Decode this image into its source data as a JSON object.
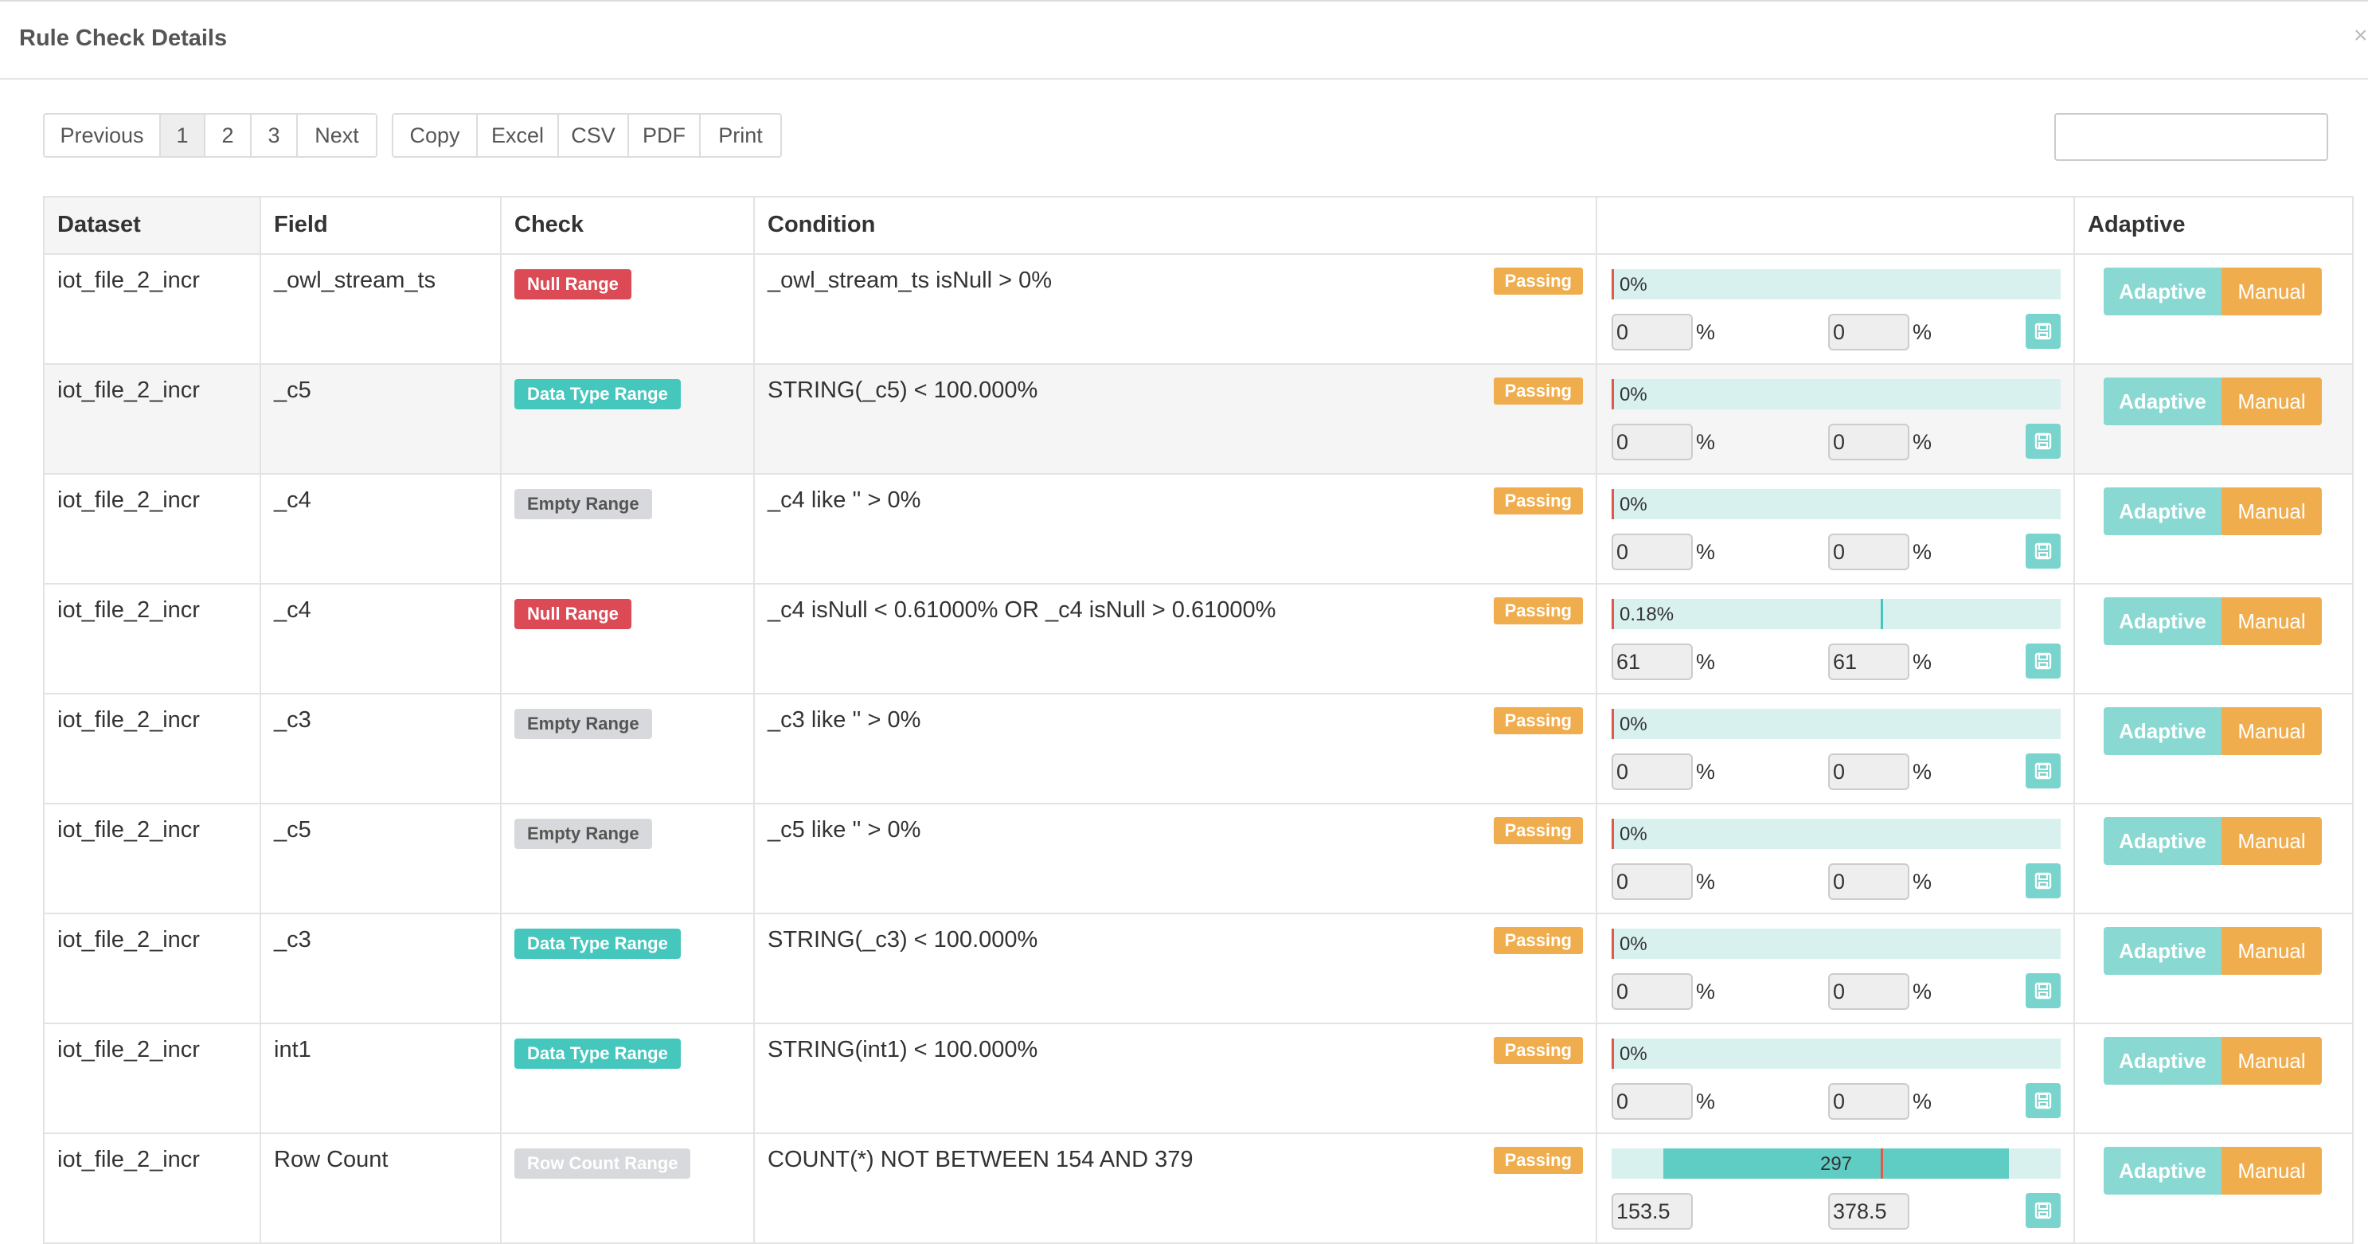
{
  "modal": {
    "title": "Rule Check Details",
    "close_glyph": "×"
  },
  "pagination": {
    "previous": "Previous",
    "pages": [
      "1",
      "2",
      "3"
    ],
    "active_page": "1",
    "next": "Next"
  },
  "export_buttons": [
    "Copy",
    "Excel",
    "CSV",
    "PDF",
    "Print"
  ],
  "search": {
    "value": "",
    "placeholder": ""
  },
  "table": {
    "headers": [
      "Dataset",
      "Field",
      "Check",
      "Condition",
      "",
      "Adaptive"
    ],
    "rows": [
      {
        "dataset": "iot_file_2_incr",
        "field": "_owl_stream_ts",
        "check": "Null Range",
        "check_type": "null",
        "condition": "_owl_stream_ts isNull > 0%",
        "status": "Passing",
        "bar_label": "0%",
        "bar_fill": 0.0,
        "bar_marker": null,
        "low": "0",
        "high": "0",
        "pct": "%",
        "adaptive": "Adaptive",
        "manual": "Manual"
      },
      {
        "dataset": "iot_file_2_incr",
        "field": "_c5",
        "check": "Data Type Range",
        "check_type": "dtype",
        "condition": "STRING(_c5) < 100.000%",
        "status": "Passing",
        "bar_label": "0%",
        "bar_fill": 0.0,
        "bar_marker": null,
        "low": "0",
        "high": "0",
        "pct": "%",
        "adaptive": "Adaptive",
        "manual": "Manual"
      },
      {
        "dataset": "iot_file_2_incr",
        "field": "_c4",
        "check": "Empty Range",
        "check_type": "empty",
        "condition": "_c4 like '' > 0%",
        "status": "Passing",
        "bar_label": "0%",
        "bar_fill": 0.0,
        "bar_marker": null,
        "low": "0",
        "high": "0",
        "pct": "%",
        "adaptive": "Adaptive",
        "manual": "Manual"
      },
      {
        "dataset": "iot_file_2_incr",
        "field": "_c4",
        "check": "Null Range",
        "check_type": "null",
        "condition": "_c4 isNull < 0.61000% OR _c4 isNull > 0.61000%",
        "status": "Passing",
        "bar_label": "0.18%",
        "bar_fill": 0.0,
        "bar_marker": 0.6,
        "low": "61",
        "high": "61",
        "pct": "%",
        "adaptive": "Adaptive",
        "manual": "Manual"
      },
      {
        "dataset": "iot_file_2_incr",
        "field": "_c3",
        "check": "Empty Range",
        "check_type": "empty",
        "condition": "_c3 like '' > 0%",
        "status": "Passing",
        "bar_label": "0%",
        "bar_fill": 0.0,
        "bar_marker": null,
        "low": "0",
        "high": "0",
        "pct": "%",
        "adaptive": "Adaptive",
        "manual": "Manual"
      },
      {
        "dataset": "iot_file_2_incr",
        "field": "_c5",
        "check": "Empty Range",
        "check_type": "empty",
        "condition": "_c5 like '' > 0%",
        "status": "Passing",
        "bar_label": "0%",
        "bar_fill": 0.0,
        "bar_marker": null,
        "low": "0",
        "high": "0",
        "pct": "%",
        "adaptive": "Adaptive",
        "manual": "Manual"
      },
      {
        "dataset": "iot_file_2_incr",
        "field": "_c3",
        "check": "Data Type Range",
        "check_type": "dtype",
        "condition": "STRING(_c3) < 100.000%",
        "status": "Passing",
        "bar_label": "0%",
        "bar_fill": 0.0,
        "bar_marker": null,
        "low": "0",
        "high": "0",
        "pct": "%",
        "adaptive": "Adaptive",
        "manual": "Manual"
      },
      {
        "dataset": "iot_file_2_incr",
        "field": "int1",
        "check": "Data Type Range",
        "check_type": "dtype",
        "condition": "STRING(int1) < 100.000%",
        "status": "Passing",
        "bar_label": "0%",
        "bar_fill": 0.0,
        "bar_marker": null,
        "low": "0",
        "high": "0",
        "pct": "%",
        "adaptive": "Adaptive",
        "manual": "Manual"
      },
      {
        "dataset": "iot_file_2_incr",
        "field": "Row Count",
        "check": "Row Count Range",
        "check_type": "rowcount",
        "condition": "COUNT(*) NOT BETWEEN 154 AND 379",
        "status": "Passing",
        "bar_label": "297",
        "bar_fill_range": [
          0.115,
          0.885
        ],
        "bar_marker": 0.6,
        "low": "153.5",
        "high": "378.5",
        "pct": "",
        "adaptive": "Adaptive",
        "manual": "Manual"
      }
    ]
  },
  "colors": {
    "passing": "#f0ad4e",
    "null_tag": "#dc4a55",
    "dtype_tag": "#45c7bd",
    "empty_tag": "#d7d9dc",
    "bar_bg": "#d8f1ef",
    "bar_fill": "#5fcdc4",
    "adaptive": "#89d8d2",
    "manual": "#f0ad4e"
  },
  "icons": {
    "save": "save-icon",
    "close": "close-icon"
  }
}
